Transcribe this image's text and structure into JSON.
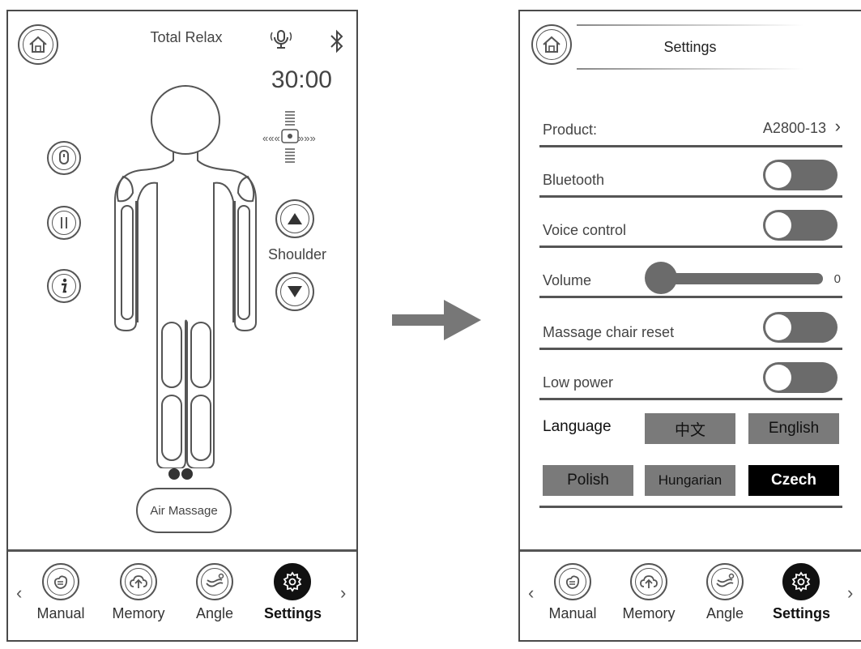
{
  "left_screen": {
    "title": "Total Relax",
    "timer": "30:00",
    "side_label": "Shoulder",
    "air_massage_label": "Air Massage",
    "icons": {
      "home": "home-icon",
      "microphone": "microphone-icon",
      "bluetooth": "bluetooth-icon",
      "voice": "voice-icon",
      "pause": "pause-icon",
      "info": "info-icon",
      "up": "arrow-up-icon",
      "down": "arrow-down-icon",
      "position": "position-indicator-icon"
    }
  },
  "right_screen": {
    "title": "Settings",
    "rows": {
      "product": {
        "label": "Product:",
        "value": "A2800-13"
      },
      "bluetooth": {
        "label": "Bluetooth"
      },
      "voice_control": {
        "label": "Voice control"
      },
      "volume": {
        "label": "Volume",
        "value": "0"
      },
      "reset": {
        "label": "Massage chair reset"
      },
      "low_power": {
        "label": "Low power"
      }
    },
    "language": {
      "label": "Language",
      "options": [
        "中文",
        "English",
        "Polish",
        "Hungarian",
        "Czech"
      ],
      "selected": "Czech"
    }
  },
  "nav": {
    "items": [
      "Manual",
      "Memory",
      "Angle",
      "Settings"
    ],
    "active": "Settings"
  },
  "colors": {
    "line": "#555555",
    "toggle_off": "#6b6b6b",
    "button_gray": "#7a7a7a",
    "selected": "#000000",
    "arrow": "#777777"
  }
}
